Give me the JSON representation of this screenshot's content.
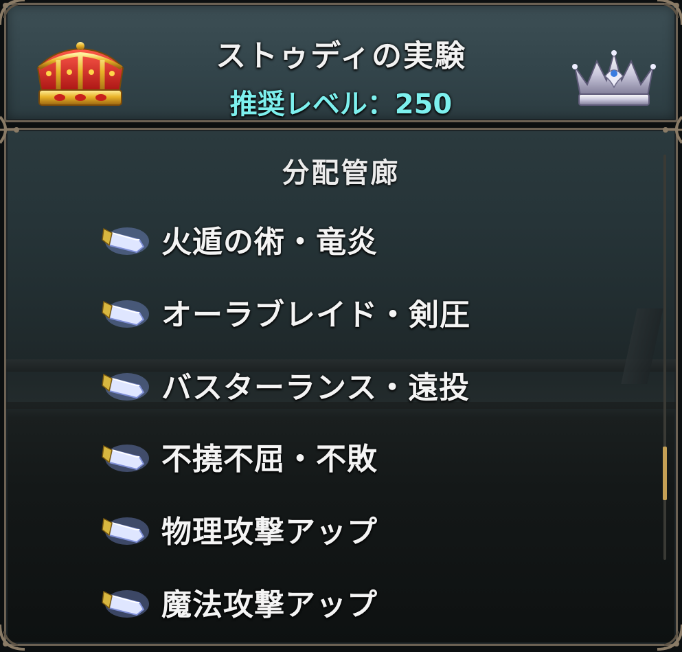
{
  "header": {
    "title": "ストゥディの実験",
    "recommended_level": "推奨レベル：250",
    "left_icon": "gold-crown-icon",
    "right_icon": "silver-crown-icon"
  },
  "section": {
    "title": "分配管廊",
    "skills": [
      {
        "label": "火遁の術・竜炎",
        "icon": "crystal-icon"
      },
      {
        "label": "オーラブレイド・剣圧",
        "icon": "crystal-icon"
      },
      {
        "label": "バスターランス・遠投",
        "icon": "crystal-icon"
      },
      {
        "label": "不撓不屈・不敗",
        "icon": "crystal-icon"
      },
      {
        "label": "物理攻撃アップ",
        "icon": "crystal-icon"
      },
      {
        "label": "魔法攻撃アップ",
        "icon": "crystal-icon"
      }
    ]
  },
  "scrollbar": {
    "position_fraction": 0.83
  },
  "colors": {
    "title_text": "#f2f2f2",
    "level_text": "#7df0ee",
    "frame_border": "#6d6254",
    "scroll_thumb": "#c5a055"
  }
}
